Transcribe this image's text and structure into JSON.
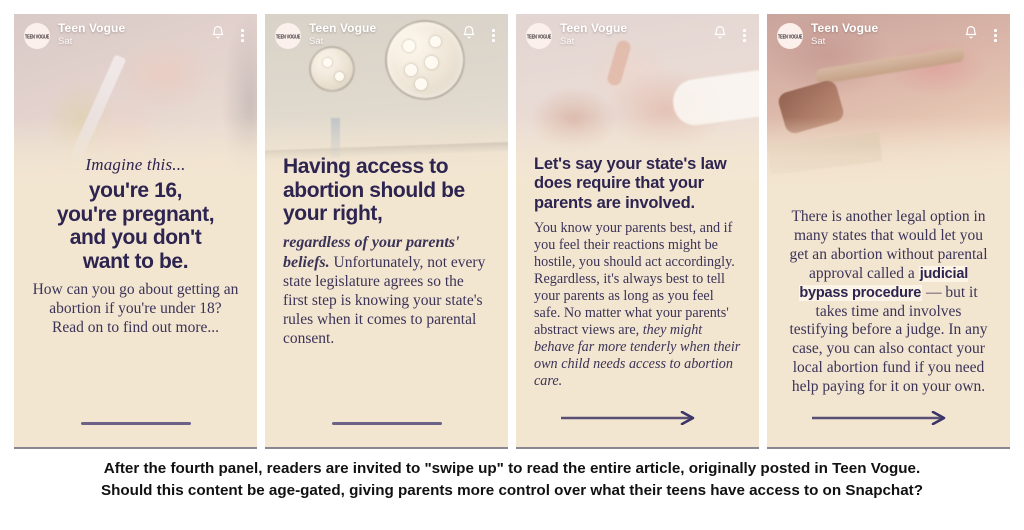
{
  "story": {
    "channel_name": "Teen Vogue",
    "timestamp": "Sat",
    "avatar_mark": "TEEN VOGUE",
    "icons": {
      "bell": "bell-icon",
      "menu": "kebab-menu-icon",
      "arrow": "arrow-right-icon"
    }
  },
  "panels": [
    {
      "id": "panel-1",
      "photo_alt": "hands-holding-pregnancy-test",
      "kicker": "Imagine this...",
      "headline": "you're 16,\nyou're pregnant,\nand you don't\nwant to be.",
      "body": "How can you go about getting an abortion if you're under 18? Read on to find out more...",
      "swipe_style": "line"
    },
    {
      "id": "panel-2",
      "photo_alt": "operating-room-lights",
      "kicker": "",
      "headline": "Having access to abortion should be your right,",
      "body_lead": "regardless of your parents' beliefs.",
      "body": "Unfortunately, not every state legislature agrees so the first step is knowing your state's rules when it comes to parental consent.",
      "swipe_style": "line"
    },
    {
      "id": "panel-3",
      "photo_alt": "clasped-hands-comfort",
      "kicker": "",
      "headline": "Let's say your state's law does require that your parents are involved.",
      "body": "You know your parents best, and if you feel their reactions might be hostile, you should act accordingly. Regardless, it's always best to tell your parents as long as you feel safe. No matter what your parents' abstract views are,",
      "body_italic": "they might behave far more tenderly when their own child needs access to abortion care.",
      "swipe_style": "arrow"
    },
    {
      "id": "panel-4",
      "photo_alt": "judge-gavel-on-desk",
      "kicker": "",
      "headline": "",
      "body_part1": "There is another legal option in many states that would let you get an abortion without parental approval called a",
      "body_highlight": "judicial bypass procedure",
      "body_part2": "— but it takes time and involves testifying before a judge. In any case, you can also contact your local abortion fund if you need help paying for it on your own.",
      "swipe_style": "arrow"
    }
  ],
  "caption": {
    "line1": "After the fourth panel, readers are invited to \"swipe up\" to read the entire article, originally posted in Teen Vogue.",
    "line2": "Should this content be age-gated, giving parents more control over what their teens have access to on Snapchat?"
  },
  "colors": {
    "panel_bg": "#f3e6d1",
    "ink": "#2d2450",
    "body_ink": "#3b3358",
    "swipe": "#6c6186",
    "highlight_bg": "#fcf4e6",
    "page_bg": "#ffffff"
  }
}
